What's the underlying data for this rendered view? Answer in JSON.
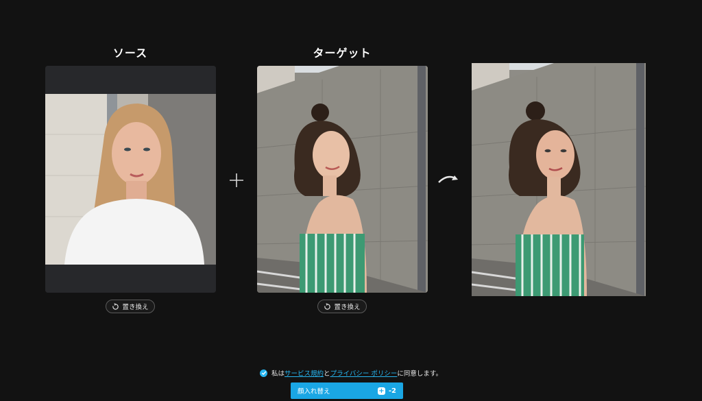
{
  "source": {
    "title": "ソース",
    "replace_label": "置き換え"
  },
  "target": {
    "title": "ターゲット",
    "replace_label": "置き換え"
  },
  "consent": {
    "prefix": "私は",
    "terms_link": "サービス規約",
    "middle": "と",
    "privacy_link": "プライバシー ポリシー",
    "suffix": "に同意します。",
    "checked": true
  },
  "action": {
    "label": "顔入れ替え",
    "credit_icon": "+",
    "credit_cost": "-2"
  },
  "colors": {
    "background": "#121212",
    "accent": "#1aa6e4",
    "link": "#27b6f0"
  }
}
